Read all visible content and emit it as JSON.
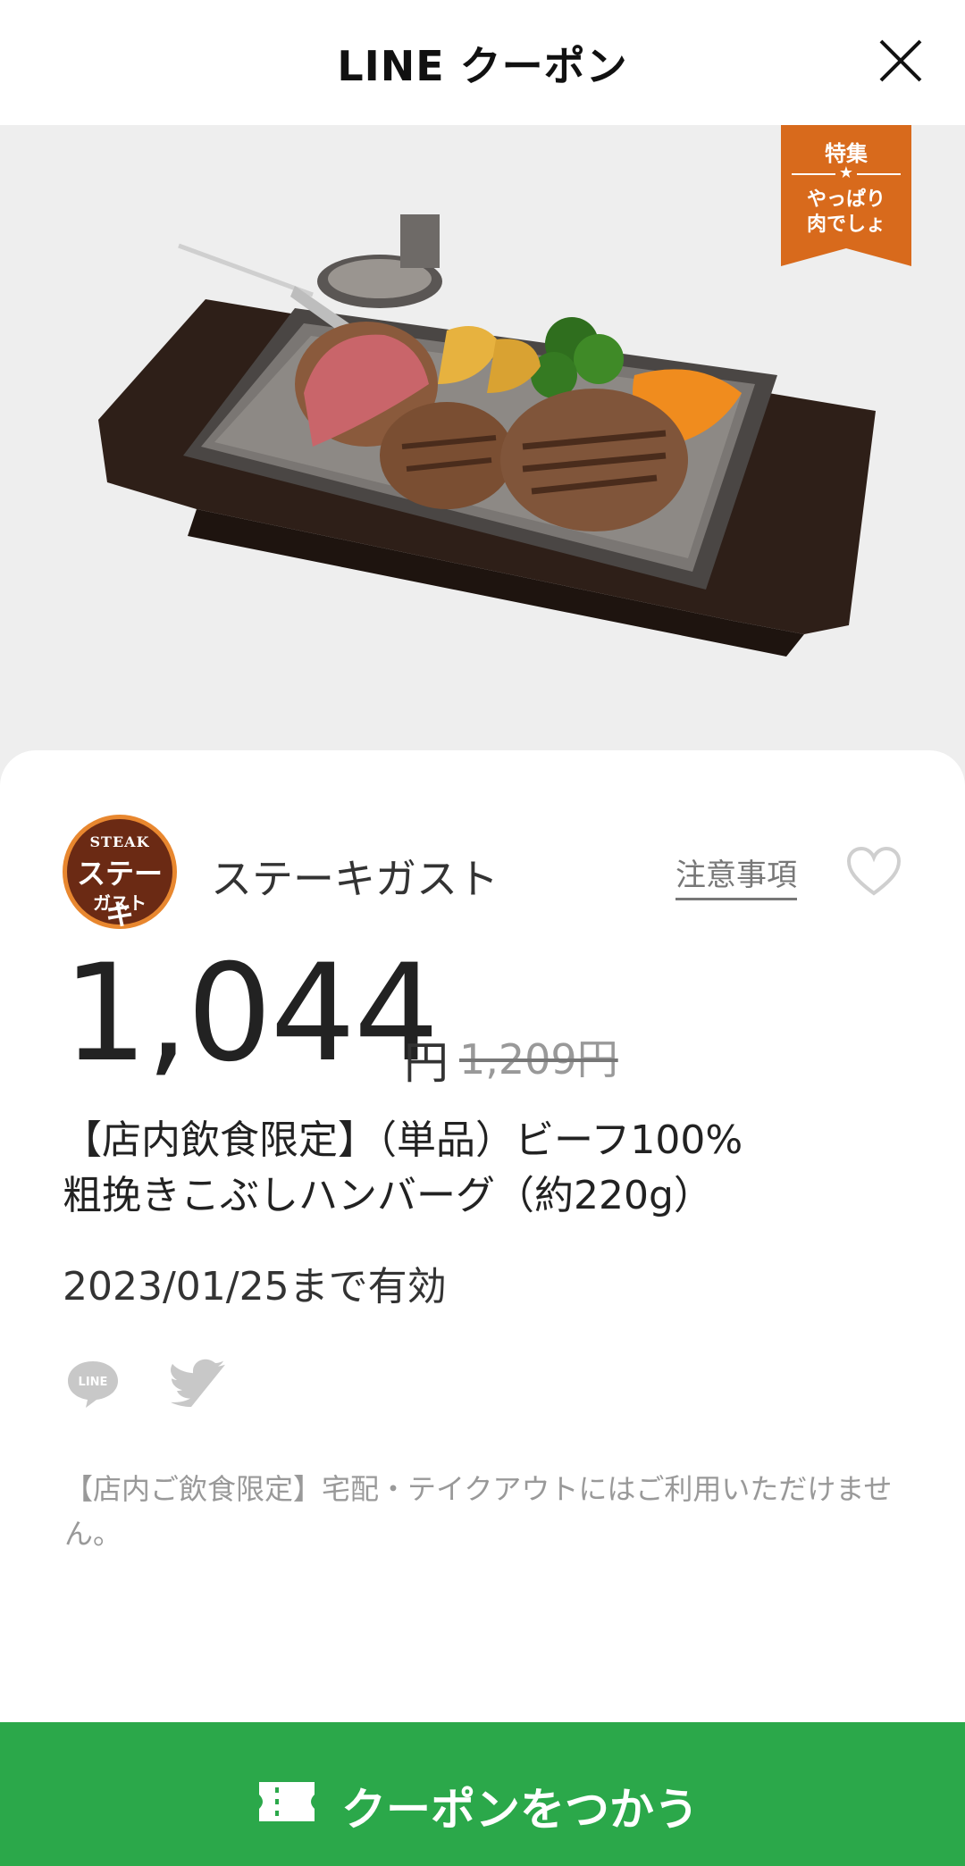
{
  "header": {
    "title": "LINE クーポン",
    "close_icon": "close-icon"
  },
  "hero": {
    "image": "steak-hamburg-plate-photo",
    "ribbon": {
      "line1": "特集",
      "star": "★",
      "line2": "やっぱり",
      "line3": "肉でしょ",
      "color": "#d86a1c"
    }
  },
  "shop": {
    "logo": {
      "top": "STEAK",
      "middle": "ステーキ",
      "bottom": "ガスト"
    },
    "name": "ステーキガスト",
    "notes_link": "注意事項",
    "favorite_icon": "heart-icon"
  },
  "coupon": {
    "price": "1,044",
    "price_unit": "円",
    "original_price": "1,209円",
    "title_line1": "【店内飲食限定】（単品）ビーフ100%",
    "title_line2": "粗挽きこぶしハンバーグ（約220g）",
    "validity": "2023/01/25まで有効"
  },
  "share": {
    "line_icon": "line-icon",
    "twitter_icon": "twitter-icon"
  },
  "notice": "【店内ご飲食限定】宅配・テイクアウトにはご利用いただけません。",
  "action": {
    "label": "クーポンをつかう",
    "icon": "ticket-icon",
    "color": "#2ba84a"
  }
}
